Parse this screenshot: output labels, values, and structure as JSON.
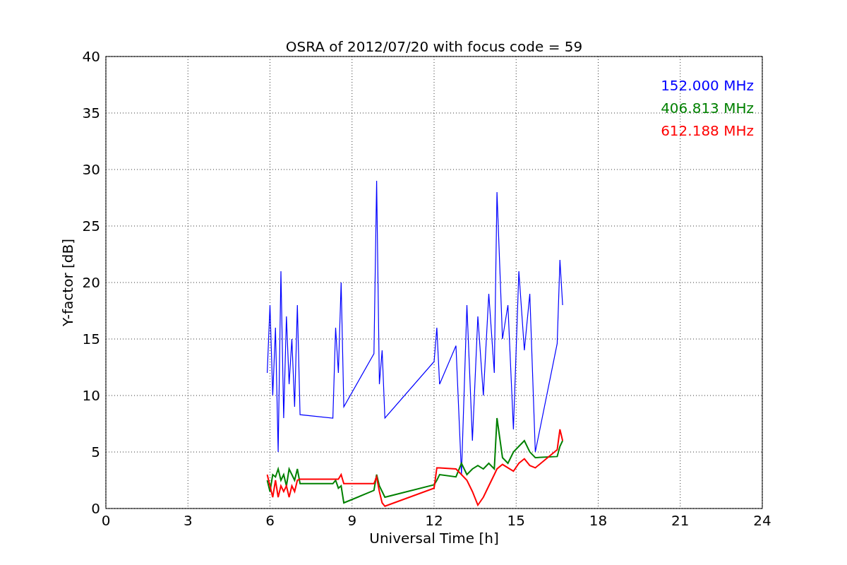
{
  "chart_data": {
    "type": "line",
    "title": "OSRA of 2012/07/20 with focus code = 59",
    "xlabel": "Universal Time [h]",
    "ylabel": "Y-factor [dB]",
    "x": [
      5.9,
      6.0,
      6.1,
      6.2,
      6.3,
      6.4,
      6.5,
      6.6,
      6.7,
      6.8,
      6.9,
      7.0,
      7.1,
      8.3,
      8.4,
      8.5,
      8.6,
      8.7,
      9.8,
      9.9,
      10.0,
      10.1,
      10.2,
      12.0,
      12.1,
      12.2,
      12.8,
      13.0,
      13.2,
      13.4,
      13.6,
      13.8,
      14.0,
      14.2,
      14.3,
      14.5,
      14.7,
      14.9,
      15.1,
      15.3,
      15.5,
      15.7,
      16.5,
      16.6,
      16.7
    ],
    "series": [
      {
        "name": "152.000 MHz",
        "color": "#0000ff",
        "values": [
          12,
          18,
          10,
          16,
          5,
          21,
          8,
          17,
          11,
          15,
          9,
          18,
          8.3,
          8,
          16,
          12,
          20,
          9,
          13.7,
          29,
          11,
          14,
          8,
          13,
          16,
          11,
          14.4,
          3,
          18,
          6,
          17,
          10,
          19,
          12,
          28,
          15,
          18,
          7,
          21,
          14,
          19,
          5,
          14.6,
          22,
          18
        ]
      },
      {
        "name": "406.813 MHz",
        "color": "#008000",
        "values": [
          2.5,
          1.5,
          3,
          2.8,
          3.5,
          2.5,
          3,
          2,
          3.5,
          3,
          2.5,
          3.5,
          2.2,
          2.2,
          2.5,
          1.8,
          2,
          0.5,
          1.6,
          3,
          2,
          1.5,
          1,
          2.1,
          2.5,
          3,
          2.8,
          4,
          3,
          3.5,
          3.8,
          3.5,
          4,
          3.5,
          8,
          4.5,
          4,
          5,
          5.5,
          6,
          5,
          4.5,
          4.6,
          5.5,
          6
        ]
      },
      {
        "name": "612.188 MHz",
        "color": "#ff0000",
        "values": [
          3,
          2,
          1,
          2.5,
          1,
          2,
          1.5,
          2,
          1,
          2,
          1.5,
          2.5,
          2.6,
          2.6,
          2.6,
          2.6,
          3,
          2.2,
          2.2,
          2.8,
          1.5,
          0.5,
          0.2,
          1.8,
          3.6,
          3.6,
          3.5,
          3,
          2.5,
          1.5,
          0.3,
          1,
          2,
          3,
          3.5,
          3.9,
          3.6,
          3.3,
          4,
          4.4,
          3.8,
          3.6,
          5.2,
          7,
          6
        ]
      }
    ],
    "grid": true,
    "xlim": [
      0,
      24
    ],
    "ylim": [
      0,
      40
    ],
    "xticks": [
      0,
      3,
      6,
      9,
      12,
      15,
      18,
      21,
      24
    ],
    "yticks": [
      0,
      5,
      10,
      15,
      20,
      25,
      30,
      35,
      40
    ]
  }
}
